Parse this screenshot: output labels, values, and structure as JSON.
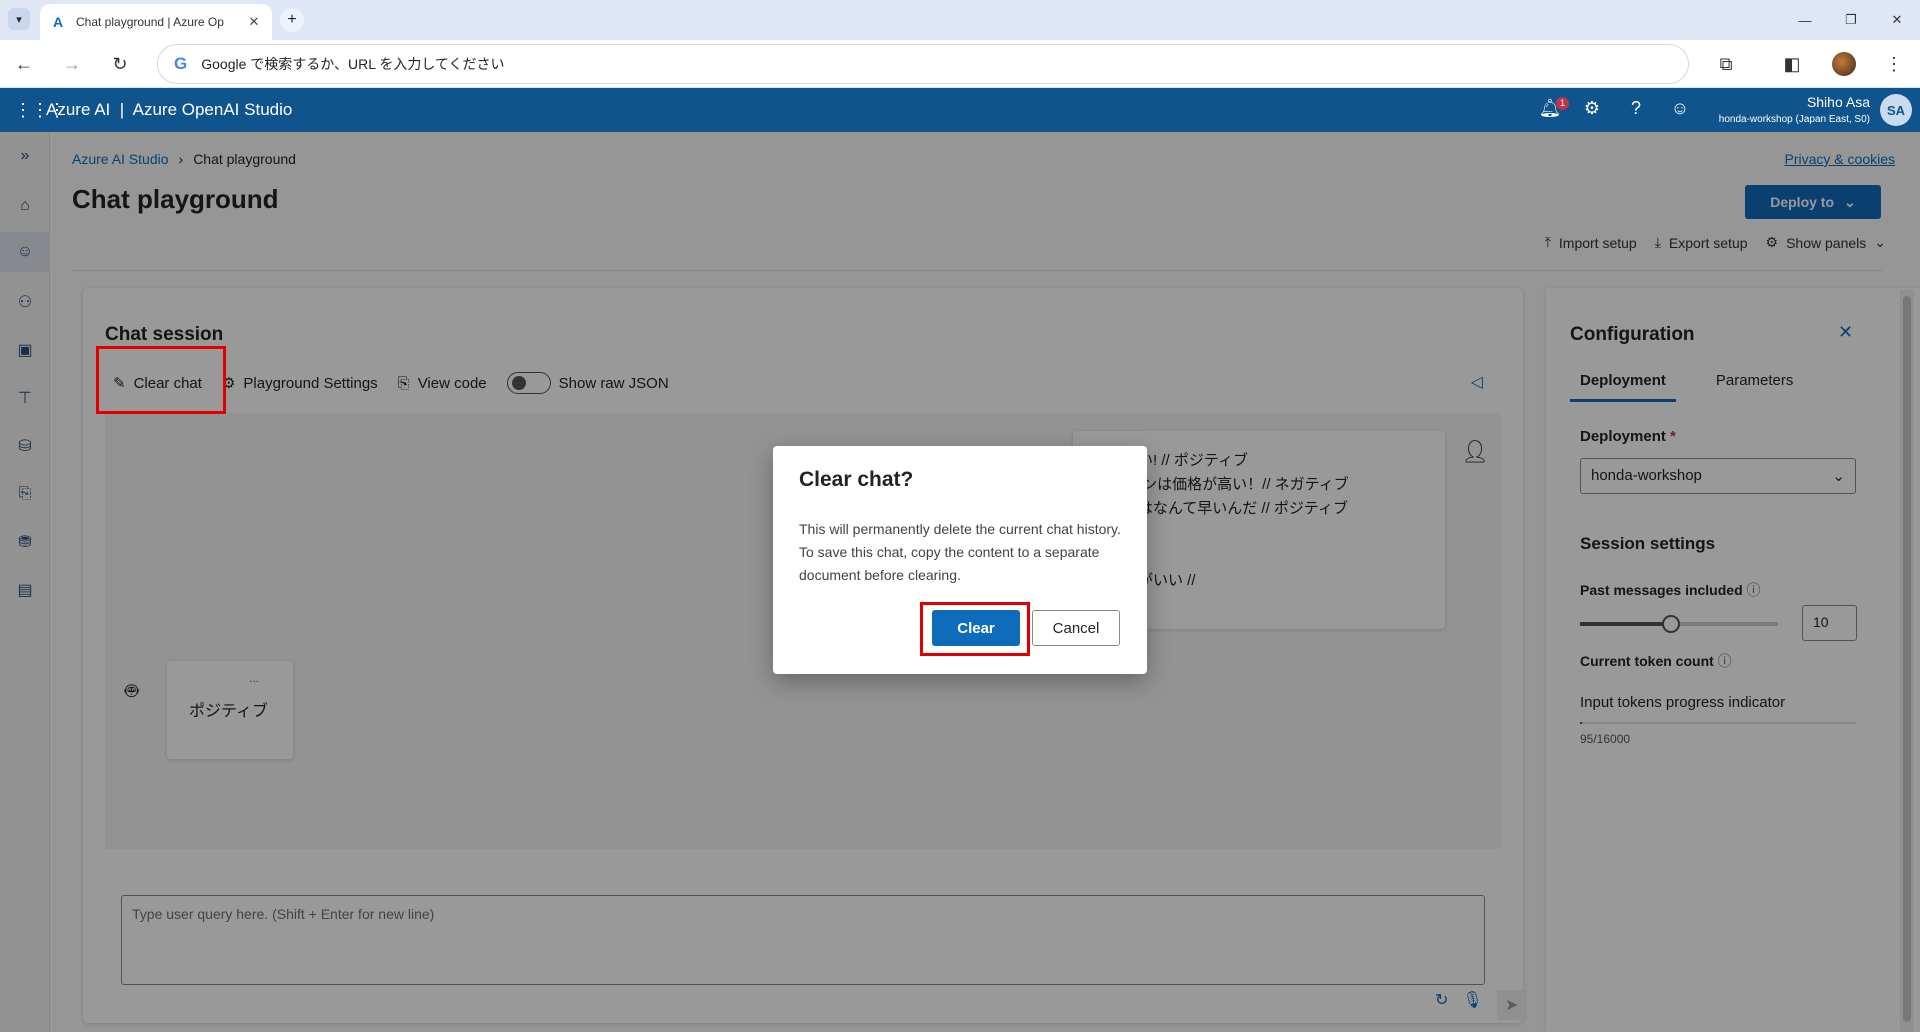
{
  "browser": {
    "tab_title": "Chat playground | Azure Op",
    "tab_close": "✕",
    "new_tab": "+",
    "omnibox_placeholder": "Google で検索するか、URL を入力してください",
    "google_glyph": "G"
  },
  "header": {
    "brand": "Azure AI  |  Azure OpenAI Studio",
    "notification_count": "1",
    "user_name": "Shiho Asa",
    "user_sub": "honda-workshop (Japan East, S0)",
    "avatar_initials": "SA"
  },
  "breadcrumb": {
    "root": "Azure AI Studio",
    "sep": "›",
    "current": "Chat playground"
  },
  "page": {
    "privacy_link": "Privacy & cookies",
    "title": "Chat playground",
    "deploy_label": "Deploy to",
    "import_setup": "Import setup",
    "export_setup": "Export setup",
    "show_panels": "Show panels"
  },
  "session": {
    "title": "Chat session",
    "clear_chat": "Clear chat",
    "playground_settings": "Playground Settings",
    "view_code": "View code",
    "show_raw_json": "Show raw JSON",
    "user_message_lines": [
      "晴らしい! // ポジティブ",
      "プ ワゴンは価格が高い！// ネガティブ",
      "YPE Rはなんて早いんだ // ポジティブ",
      "",
      "",
      "は燃費がいい //"
    ],
    "bot_dots": "...",
    "bot_reply": "ポジティブ",
    "input_placeholder": "Type user query here. (Shift + Enter for new line)"
  },
  "config": {
    "title": "Configuration",
    "tab_deployment": "Deployment",
    "tab_parameters": "Parameters",
    "deployment_label": "Deployment",
    "required_mark": "*",
    "deployment_value": "honda-workshop",
    "session_settings": "Session settings",
    "past_messages_label": "Past messages included",
    "past_messages_value": "10",
    "past_messages_fraction": 0.46,
    "token_count_label": "Current token count",
    "input_tokens_label": "Input tokens progress indicator",
    "tokens_used": 95,
    "tokens_max": 16000,
    "token_text": "95/16000"
  },
  "dialog": {
    "title": "Clear chat?",
    "body": "This will permanently delete the current chat history. To save this chat, copy the content to a separate document before clearing.",
    "confirm": "Clear",
    "cancel": "Cancel"
  },
  "colors": {
    "azure_header": "#0f548c",
    "primary_button": "#0f6cbd",
    "highlight_box": "#e00000"
  }
}
